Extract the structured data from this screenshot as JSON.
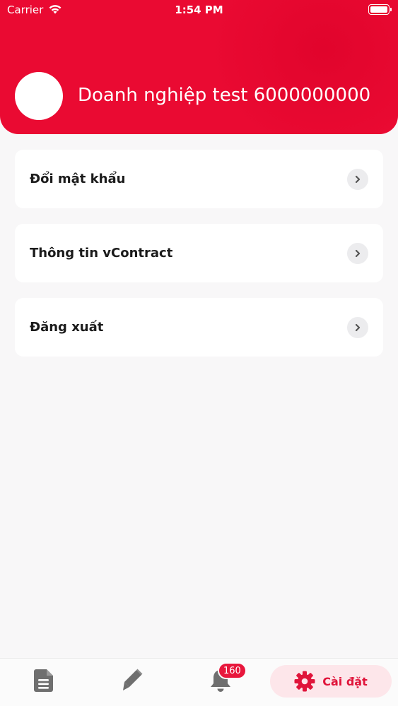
{
  "status_bar": {
    "carrier": "Carrier",
    "time": "1:54 PM"
  },
  "profile": {
    "company_name": "Doanh nghiệp test 6000000000"
  },
  "menu": {
    "items": [
      {
        "label": "Đổi mật khẩu"
      },
      {
        "label": "Thông tin vContract"
      },
      {
        "label": "Đăng xuất"
      }
    ]
  },
  "tabbar": {
    "notification_count": "160",
    "settings_label": "Cài đặt",
    "icons": [
      "document-icon",
      "pen-icon",
      "bell-icon",
      "gear-icon"
    ]
  },
  "colors": {
    "brand": "#ea0a32",
    "active_tab_bg": "#fde6ea",
    "icon_gray": "#6f6f6f"
  }
}
